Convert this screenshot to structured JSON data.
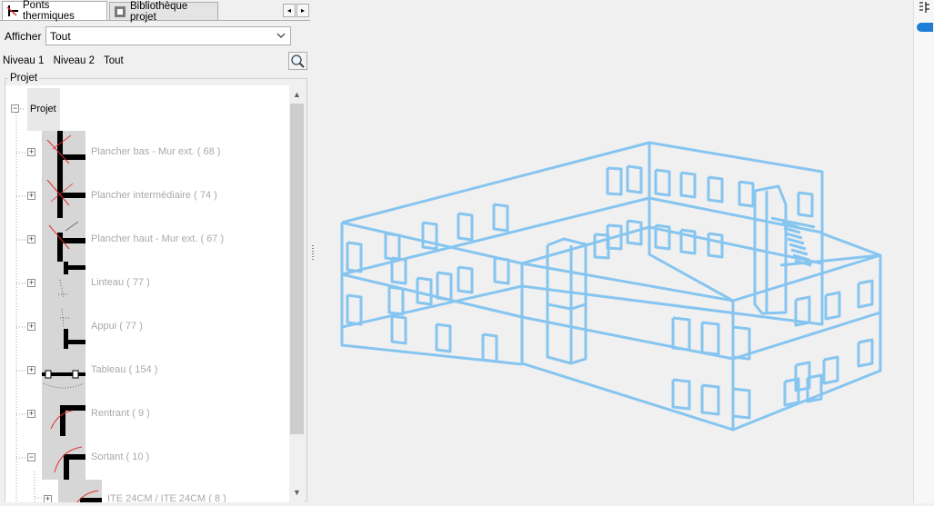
{
  "tabs": [
    {
      "label": "Ponts thermiques",
      "active": true
    },
    {
      "label": "Bibliothèque projet",
      "active": false
    }
  ],
  "nav": {
    "prev": "◂",
    "next": "▸"
  },
  "filter": {
    "label": "Afficher",
    "value": "Tout"
  },
  "levels": [
    "Niveau 1",
    "Niveau 2",
    "Tout"
  ],
  "group_label": "Projet",
  "tree": {
    "root": "Projet",
    "items": [
      {
        "label": "Plancher bas - Mur ext. ( 68 )",
        "icon": "floor-wall-junction-icon",
        "expanded": false
      },
      {
        "label": "Plancher intermédiaire ( 74 )",
        "icon": "intermediate-floor-icon",
        "expanded": false
      },
      {
        "label": "Plancher haut - Mur ext. ( 67 )",
        "icon": "roof-wall-junction-icon",
        "expanded": false
      },
      {
        "label": "Linteau ( 77 )",
        "icon": "lintel-icon",
        "expanded": false
      },
      {
        "label": "Appui ( 77 )",
        "icon": "sill-icon",
        "expanded": false
      },
      {
        "label": "Tableau ( 154 )",
        "icon": "jamb-icon",
        "expanded": false
      },
      {
        "label": "Rentrant ( 9 )",
        "icon": "inner-corner-icon",
        "expanded": false
      },
      {
        "label": "Sortant ( 10 )",
        "icon": "outer-corner-icon",
        "expanded": true
      }
    ],
    "child": {
      "label": "ITE 24CM / ITE 24CM ( 8 )",
      "icon": "outer-corner-icon"
    }
  },
  "colors": {
    "wireframe": "#86c5f0",
    "accent": "#1f7ed6",
    "thermal": "#e03030"
  }
}
